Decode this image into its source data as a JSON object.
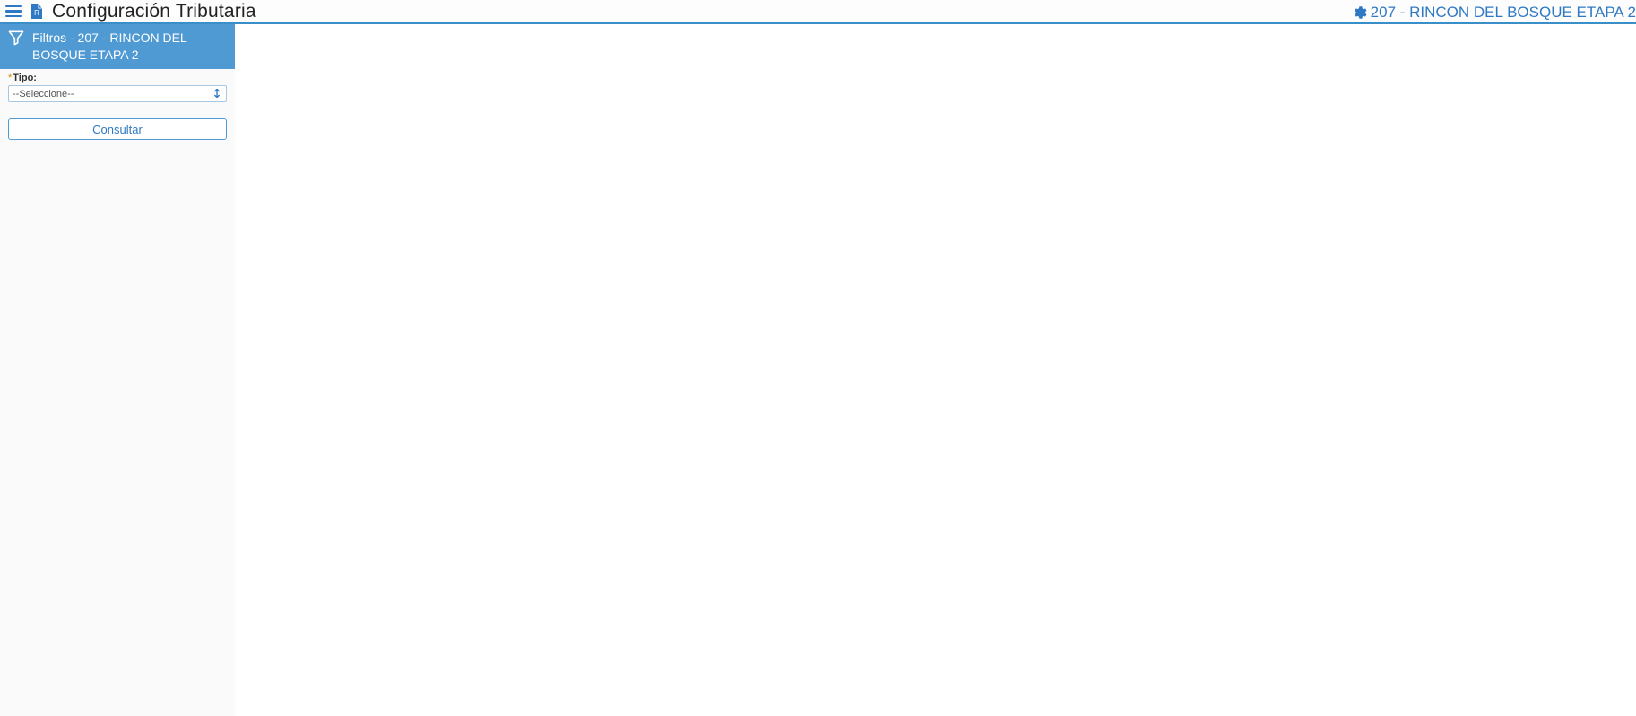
{
  "header": {
    "page_title": "Configuración Tributaria",
    "context_label": "207 - RINCON DEL BOSQUE ETAPA 2"
  },
  "sidebar": {
    "filter_header": "Filtros - 207 - RINCON DEL BOSQUE ETAPA 2",
    "field": {
      "required_mark": "*",
      "label": "Tipo:",
      "selected_value": "--Seleccione--"
    },
    "consult_button": "Consultar"
  }
}
